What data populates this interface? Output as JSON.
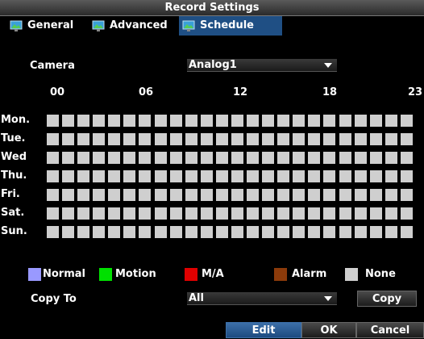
{
  "window": {
    "title": "Record Settings"
  },
  "tabs": [
    {
      "label": "General",
      "icon": "monitor-icon",
      "active": false
    },
    {
      "label": "Advanced",
      "icon": "monitor-icon",
      "active": false
    },
    {
      "label": "Schedule",
      "icon": "monitor-icon",
      "active": true
    }
  ],
  "camera": {
    "label": "Camera",
    "value": "Analog1"
  },
  "hours": [
    "00",
    "06",
    "12",
    "18",
    "23"
  ],
  "days": [
    "Mon.",
    "Tue.",
    "Wed",
    "Thu.",
    "Fri.",
    "Sat.",
    "Sun."
  ],
  "schedule": {
    "cell_state": "None",
    "none_color": "#cfcfcf"
  },
  "legend": [
    {
      "label": "Normal",
      "color": "#9999ff"
    },
    {
      "label": "Motion",
      "color": "#00e000"
    },
    {
      "label": "M/A",
      "color": "#e00000"
    },
    {
      "label": "Alarm",
      "color": "#8b3a0a"
    },
    {
      "label": "None",
      "color": "#cfcfcf"
    }
  ],
  "copy_to": {
    "label": "Copy To",
    "value": "All",
    "button": "Copy"
  },
  "footer": {
    "edit": "Edit",
    "ok": "OK",
    "cancel": "Cancel"
  },
  "colors": {
    "active_tab": "#1f4f84",
    "edit_button": "#2a5a94"
  }
}
